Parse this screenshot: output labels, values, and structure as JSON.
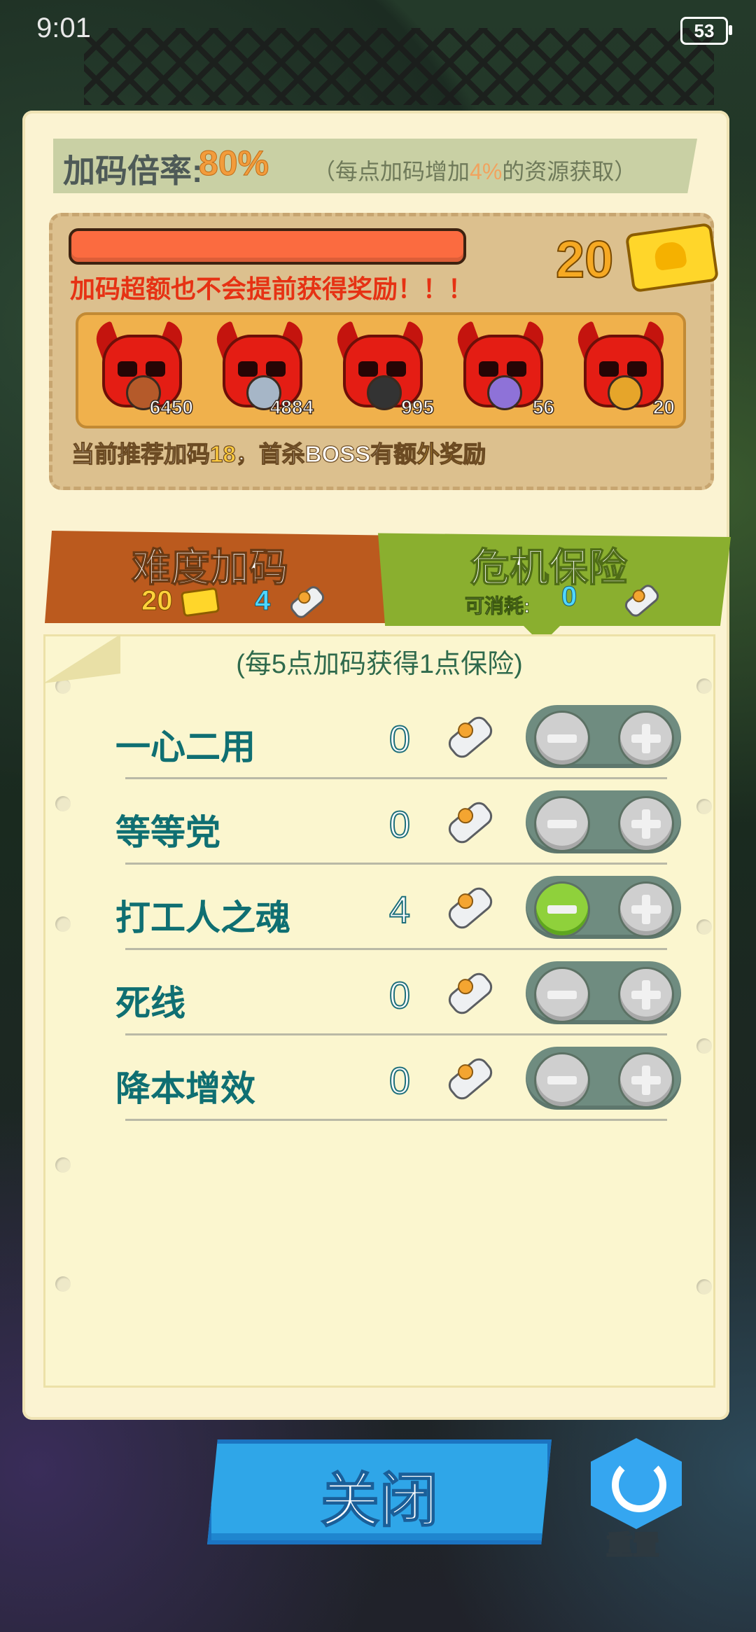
{
  "status_bar": {
    "time": "9:01",
    "battery": "53"
  },
  "header": {
    "rate_label": "加码倍率:",
    "rate_value": "80%",
    "rate_desc_pre": "（每点加码增加",
    "rate_desc_pct": "4%",
    "rate_desc_post": "的资源获取）"
  },
  "reward": {
    "warning": "加码超额也不会提前获得奖励！！！",
    "ticket_count": "20",
    "bosses": [
      {
        "item_icon": "barrel-icon",
        "count": "6450",
        "item_color": "#b55a2a"
      },
      {
        "item_icon": "screw-icon",
        "count": "4884",
        "item_color": "#a6b6c7"
      },
      {
        "item_icon": "battery-icon",
        "count": "995",
        "item_color": "#333333"
      },
      {
        "item_icon": "potion-icon",
        "count": "56",
        "item_color": "#8e72d8"
      },
      {
        "item_icon": "crown-icon",
        "count": "20",
        "item_color": "#e6a52a"
      }
    ],
    "recommend_pre": "当前推荐加码",
    "recommend_num": "18",
    "recommend_mid": "，首杀BOSS有",
    "recommend_hl": "额外奖励"
  },
  "tabs": {
    "difficulty": {
      "title": "难度加码",
      "tickets": "20",
      "scrolls": "4"
    },
    "insurance": {
      "title": "危机保险",
      "consumable_label": "可消耗:",
      "consumable": "0"
    }
  },
  "list": {
    "header": "(每5点加码获得1点保险)",
    "rows": [
      {
        "name": "一心二用",
        "value": "0"
      },
      {
        "name": "等等党",
        "value": "0"
      },
      {
        "name": "打工人之魂",
        "value": "4"
      },
      {
        "name": "死线",
        "value": "0"
      },
      {
        "name": "降本增效",
        "value": "0"
      }
    ]
  },
  "buttons": {
    "close": "关闭",
    "reset": "重置"
  },
  "colors": {
    "accent_orange": "#f29c3c",
    "tab_difficulty": "#bb5a1e",
    "tab_insurance": "#8aaf2f",
    "close_button": "#2fa6e8"
  }
}
